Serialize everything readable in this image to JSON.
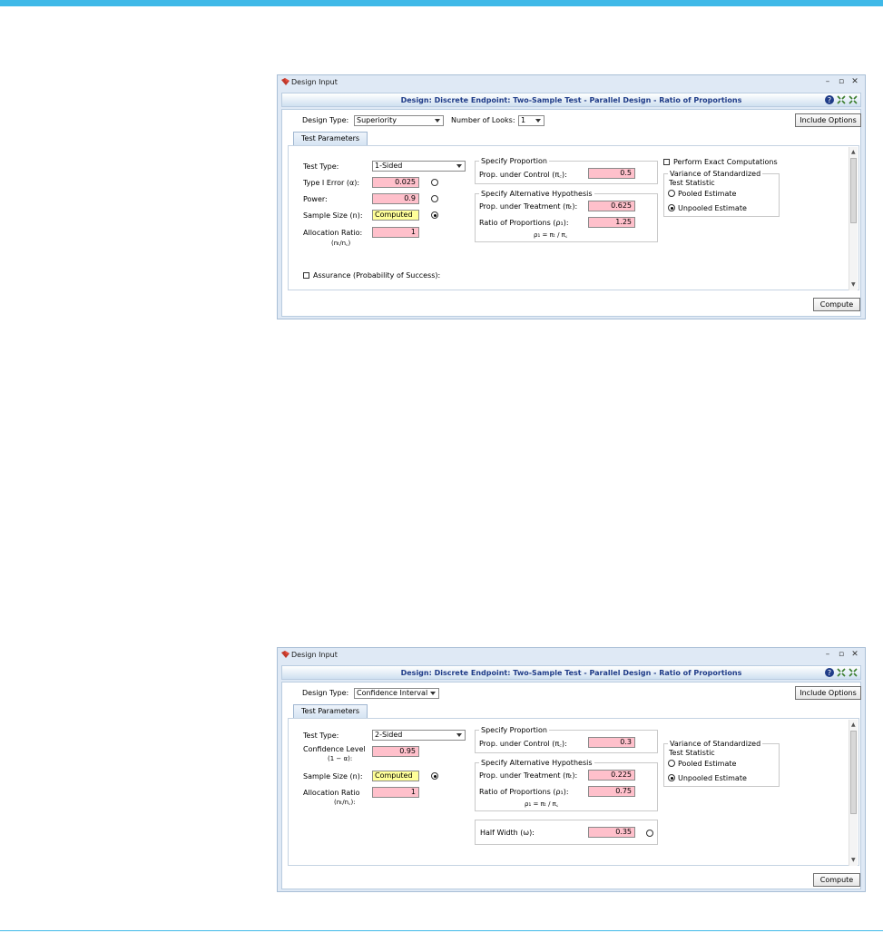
{
  "colors": {
    "accent": "#3fb9e8",
    "title_blue": "#1f3c88",
    "required_input": "#ffc0cb",
    "computed_input": "#ffff99"
  },
  "window1": {
    "title": "Design Input",
    "design_header": "Design: Discrete Endpoint: Two-Sample Test - Parallel Design - Ratio of Proportions",
    "design_type_label": "Design Type:",
    "design_type_value": "Superiority",
    "looks_label": "Number of Looks:",
    "looks_value": "1",
    "include_options": "Include Options",
    "tab": "Test Parameters",
    "test_type_label": "Test Type:",
    "test_type_value": "1-Sided",
    "type1_label": "Type I Error (α):",
    "type1_value": "0.025",
    "power_label": "Power:",
    "power_value": "0.9",
    "sample_label": "Sample Size (n):",
    "sample_value": "Computed",
    "alloc_label": "Allocation Ratio:",
    "alloc_sub": "(nₜ/n꜀)",
    "alloc_value": "1",
    "assurance_label": "Assurance (Probability of Success):",
    "spec_prop_title": "Specify Proportion",
    "prop_control_label": "Prop. under Control (π꜀):",
    "prop_control_value": "0.5",
    "alt_hyp_title": "Specify Alternative Hypothesis",
    "prop_treat_label": "Prop. under Treatment (πₜ):",
    "prop_treat_value": "0.625",
    "ratio_label": "Ratio of Proportions (ρ₁):",
    "ratio_value": "1.25",
    "ratio_formula": "ρ₁ = πₜ / π꜀",
    "exact_label": "Perform Exact Computations",
    "variance_title": "Variance of Standardized",
    "variance_title2": "Test Statistic",
    "pooled_label": "Pooled Estimate",
    "unpooled_label": "Unpooled Estimate",
    "compute": "Compute"
  },
  "window2": {
    "title": "Design Input",
    "design_header": "Design: Discrete Endpoint: Two-Sample Test - Parallel Design - Ratio of Proportions",
    "design_type_label": "Design Type:",
    "design_type_value": "Confidence Interval",
    "include_options": "Include Options",
    "tab": "Test Parameters",
    "test_type_label": "Test Type:",
    "test_type_value": "2-Sided",
    "conf_label": "Confidence Level",
    "conf_sub": "(1 − α):",
    "conf_value": "0.95",
    "sample_label": "Sample Size (n):",
    "sample_value": "Computed",
    "alloc_label": "Allocation Ratio",
    "alloc_sub": "(nₜ/n꜀):",
    "alloc_value": "1",
    "spec_prop_title": "Specify Proportion",
    "prop_control_label": "Prop. under Control (π꜀):",
    "prop_control_value": "0.3",
    "alt_hyp_title": "Specify Alternative Hypothesis",
    "prop_treat_label": "Prop. under Treatment (πₜ):",
    "prop_treat_value": "0.225",
    "ratio_label": "Ratio of Proportions (ρ₁):",
    "ratio_value": "0.75",
    "ratio_formula": "ρ₁ = πₜ / π꜀",
    "half_width_label": "Half Width (ω):",
    "half_width_value": "0.35",
    "variance_title": "Variance of Standardized",
    "variance_title2": "Test Statistic",
    "pooled_label": "Pooled Estimate",
    "unpooled_label": "Unpooled Estimate",
    "compute": "Compute"
  }
}
